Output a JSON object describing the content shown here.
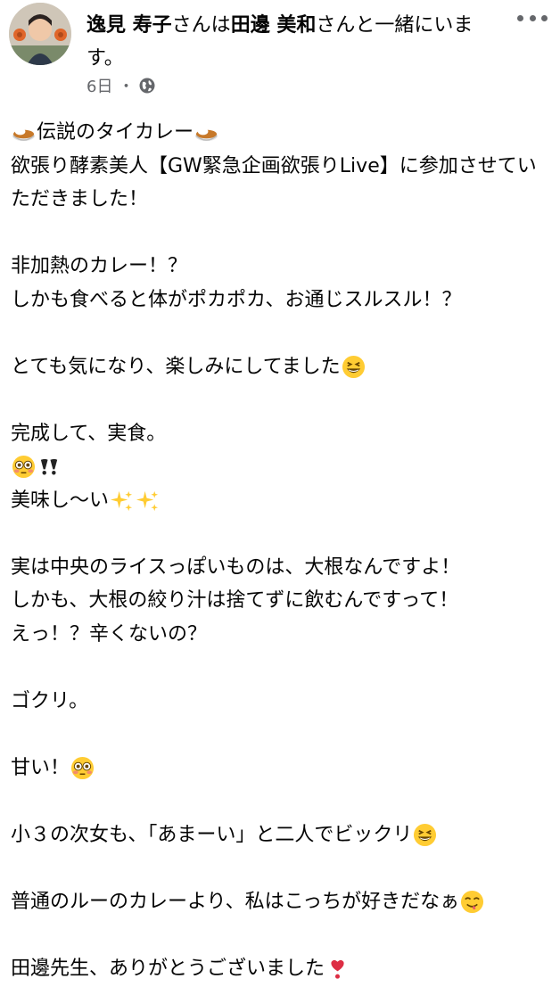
{
  "post": {
    "author_name": "逸見 寿子",
    "tag_connector": "さんは",
    "tagged_name": "田邊 美和",
    "tag_suffix": "さんと一緒にいます。",
    "timestamp": "6日",
    "meta_separator": "・",
    "privacy_icon": "globe-icon",
    "more_icon": "more-options-icon"
  },
  "body": {
    "line_1_text": "伝説のタイカレー",
    "line_2": "欲張り酵素美人【GW緊急企画欲張りLive】に参加させていただきました！",
    "line_3": "非加熱のカレー！？",
    "line_4": "しかも食べると体がポカポカ、お通じスルスル！？",
    "line_5_text": "とても気になり、楽しみにしてました",
    "line_6": "完成して、実食。",
    "line_8_text": "美味し〜い",
    "line_9": "実は中央のライスっぽいものは、大根なんですよ！",
    "line_10": "しかも、大根の絞り汁は捨てずに飲むんですって！",
    "line_11": "えっ！？辛くないの？",
    "line_12": "ゴクリ。",
    "line_13_text": "甘い！",
    "line_14_text": "小３の次女も、「あまーい」と二人でビックリ",
    "line_15_text": "普通のルーのカレーより、私はこっちが好きだなぁ",
    "line_16_text": "田邊先生、ありがとうございました"
  },
  "colors": {
    "text": "#050505",
    "secondary": "#65676b",
    "background": "#ffffff"
  }
}
